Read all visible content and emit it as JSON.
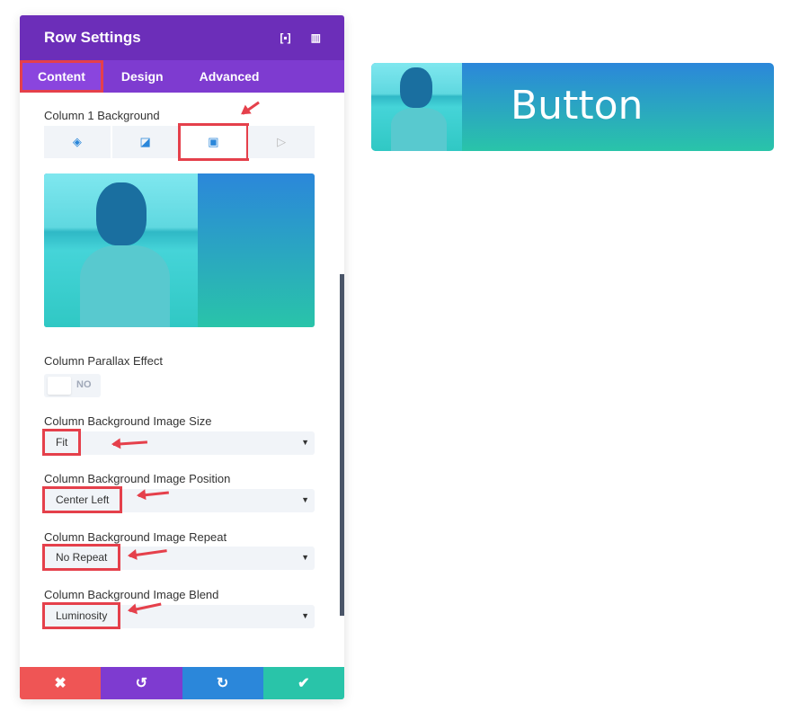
{
  "panel": {
    "title": "Row Settings",
    "tabs": [
      "Content",
      "Design",
      "Advanced"
    ],
    "active_tab": "Content"
  },
  "section": {
    "label": "Column 1 Background",
    "types": [
      "color-icon",
      "gradient-icon",
      "image-icon",
      "video-icon"
    ],
    "selected": "image-icon"
  },
  "parallax": {
    "label": "Column Parallax Effect",
    "value": "NO"
  },
  "fields": [
    {
      "label": "Column Background Image Size",
      "value": "Fit"
    },
    {
      "label": "Column Background Image Position",
      "value": "Center Left"
    },
    {
      "label": "Column Background Image Repeat",
      "value": "No Repeat"
    },
    {
      "label": "Column Background Image Blend",
      "value": "Luminosity"
    }
  ],
  "footer": {
    "cancel": "✖",
    "undo": "↺",
    "redo": "↻",
    "save": "✔"
  },
  "preview_button": {
    "label": "Button"
  },
  "colors": {
    "header": "#6c2eb9",
    "tabs": "#7e3bd0",
    "highlight": "#e5404b",
    "gradient_top": "#2b87da",
    "gradient_bottom": "#29c4a9",
    "cancel": "#ef5555",
    "undo": "#7e3bd0",
    "redo": "#2b87da",
    "save": "#29c4a9"
  }
}
